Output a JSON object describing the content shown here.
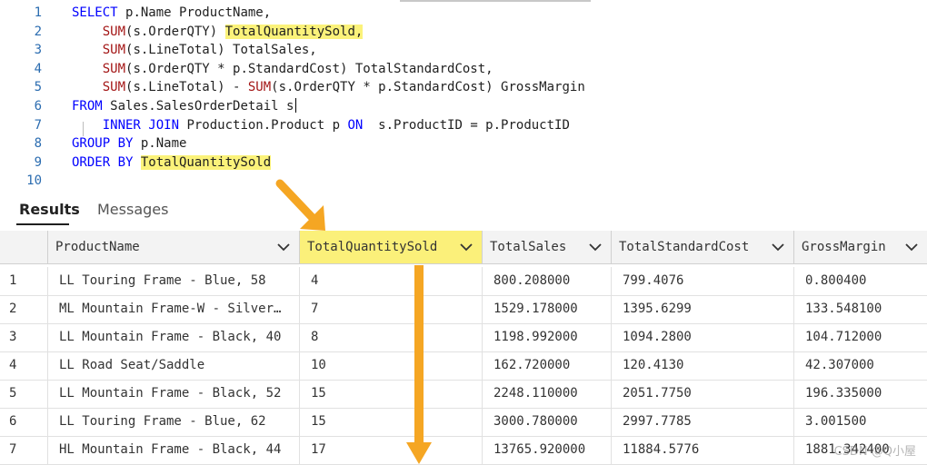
{
  "editor": {
    "lines": [
      {
        "num": "1",
        "parts": [
          {
            "t": "SELECT ",
            "c": "kw"
          },
          {
            "t": "p.Name ProductName,",
            "c": ""
          }
        ]
      },
      {
        "num": "2",
        "parts": [
          {
            "t": "    ",
            "c": ""
          },
          {
            "t": "SUM",
            "c": "fn"
          },
          {
            "t": "(s.OrderQTY) ",
            "c": ""
          },
          {
            "t": "TotalQuantitySold,",
            "c": "hl2"
          }
        ]
      },
      {
        "num": "3",
        "parts": [
          {
            "t": "    ",
            "c": ""
          },
          {
            "t": "SUM",
            "c": "fn"
          },
          {
            "t": "(s.LineTotal) TotalSales,",
            "c": ""
          }
        ]
      },
      {
        "num": "4",
        "parts": [
          {
            "t": "    ",
            "c": ""
          },
          {
            "t": "SUM",
            "c": "fn"
          },
          {
            "t": "(s.OrderQTY * p.StandardCost) TotalStandardCost,",
            "c": ""
          }
        ]
      },
      {
        "num": "5",
        "parts": [
          {
            "t": "    ",
            "c": ""
          },
          {
            "t": "SUM",
            "c": "fn"
          },
          {
            "t": "(s.LineTotal) - ",
            "c": ""
          },
          {
            "t": "SUM",
            "c": "fn"
          },
          {
            "t": "(s.OrderQTY * p.StandardCost) GrossMargin",
            "c": ""
          }
        ]
      },
      {
        "num": "6",
        "parts": [
          {
            "t": "FROM ",
            "c": "kw"
          },
          {
            "t": "Sales.SalesOrderDetail s",
            "c": ""
          }
        ]
      },
      {
        "num": "7",
        "parts": [
          {
            "t": "    ",
            "c": ""
          },
          {
            "t": "INNER JOIN ",
            "c": "kw"
          },
          {
            "t": "Production.Product p ",
            "c": ""
          },
          {
            "t": "ON",
            "c": "kw"
          },
          {
            "t": "  s.ProductID = p.ProductID",
            "c": ""
          }
        ]
      },
      {
        "num": "8",
        "parts": [
          {
            "t": "GROUP BY ",
            "c": "kw"
          },
          {
            "t": "p.Name",
            "c": ""
          }
        ]
      },
      {
        "num": "9",
        "parts": [
          {
            "t": "ORDER BY ",
            "c": "kw"
          },
          {
            "t": "TotalQuantitySold",
            "c": "hl2"
          }
        ]
      },
      {
        "num": "10",
        "parts": []
      }
    ]
  },
  "tabs": {
    "results": "Results",
    "messages": "Messages"
  },
  "grid": {
    "columns": [
      "ProductName",
      "TotalQuantitySold",
      "TotalSales",
      "TotalStandardCost",
      "GrossMargin"
    ],
    "rows": [
      [
        "1",
        "LL Touring Frame - Blue, 58",
        "4",
        "800.208000",
        "799.4076",
        "0.800400"
      ],
      [
        "2",
        "ML Mountain Frame-W - Silver…",
        "7",
        "1529.178000",
        "1395.6299",
        "133.548100"
      ],
      [
        "3",
        "LL Mountain Frame - Black, 40",
        "8",
        "1198.992000",
        "1094.2800",
        "104.712000"
      ],
      [
        "4",
        "LL Road Seat/Saddle",
        "10",
        "162.720000",
        "120.4130",
        "42.307000"
      ],
      [
        "5",
        "LL Mountain Frame - Black, 52",
        "15",
        "2248.110000",
        "2051.7750",
        "196.335000"
      ],
      [
        "6",
        "LL Touring Frame - Blue, 62",
        "15",
        "3000.780000",
        "2997.7785",
        "3.001500"
      ],
      [
        "7",
        "HL Mountain Frame - Black, 44",
        "17",
        "13765.920000",
        "11884.5776",
        "1881.342400"
      ]
    ]
  },
  "watermark": "CSDN @Q小屋",
  "colors": {
    "highlight": "#fbf07a",
    "arrow": "#f5a623",
    "keyword": "#0000ff",
    "function": "#a31515",
    "line_number": "#2b6cb0"
  },
  "icons": {
    "column_menu": "chevron-down-icon",
    "arrow_down": "arrow-down-icon"
  }
}
